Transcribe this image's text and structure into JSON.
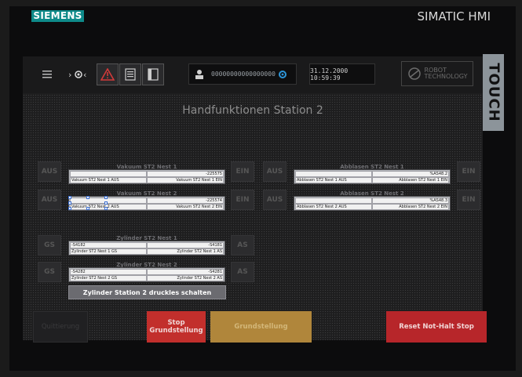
{
  "brand": "SIEMENS",
  "product": "SIMATIC HMI",
  "touch_label": "TOUCH",
  "topbar": {
    "menu_icon": "hamburger-icon",
    "icons": [
      "gearhead-icon",
      "warning-icon",
      "list-icon",
      "screen-icon"
    ],
    "status_value": "00000000000000000",
    "datetime": "31.12.2000 10:59:39",
    "logo_line1": "ROBOT",
    "logo_line2": "TECHNOLOGY"
  },
  "title": "Handfunktionen Station 2",
  "left_buttons": [
    "AUS",
    "AUS",
    "GS",
    "GS"
  ],
  "right_buttons_left": [
    "EIN",
    "EIN",
    "AS",
    "AS"
  ],
  "mid_buttons": [
    "AUS",
    "AUS"
  ],
  "right_buttons_right": [
    "EIN",
    "EIN"
  ],
  "panels": [
    {
      "title": "Vakuum ST2 Nest 1",
      "top_left": "",
      "top_right": "-225575",
      "bot_left": "Vakuum ST2 Nest 1 AUS",
      "bot_right": "Vakuum ST2 Nest 1 EIN"
    },
    {
      "title": "Vakuum ST2 Nest 2",
      "top_left": "",
      "top_right": "-225574",
      "bot_left": "Vakuum ST2 Nest 2 AUS",
      "bot_right": "Vakuum ST2 Nest 2 EIN"
    },
    {
      "title": "Abblasen ST2 Nest 1",
      "top_left": "",
      "top_right": "%AS48.2",
      "bot_left": "Abblasen ST2 Nest 1 AUS",
      "bot_right": "Abblasen ST2 Nest 1 EIN"
    },
    {
      "title": "Abblasen ST2 Nest 2",
      "top_left": "",
      "top_right": "%AS48.3",
      "bot_left": "Abblasen ST2 Nest 2 AUS",
      "bot_right": "Abblasen ST2 Nest 2 EIN"
    },
    {
      "title": "Zylinder ST2 Nest 1",
      "top_left": "-S4182",
      "top_right": "-S4181",
      "bot_left": "Zylinder ST2 Nest 1 GS",
      "bot_right": "Zylinder ST2 Nest 1 AS"
    },
    {
      "title": "Zylinder ST2 Nest 2",
      "top_left": "-S4282",
      "top_right": "-S4281",
      "bot_left": "Zylinder ST2 Nest 2 GS",
      "bot_right": "Zylinder ST2 Nest 2 AS"
    }
  ],
  "wide_button": "Zylinder Station 2 druckles schalten",
  "bottom": {
    "quittierung": "Quittierung",
    "stop": "Stop Grundstellung",
    "grundstellung": "Grundstellung",
    "reset": "Reset Not-Halt Stop"
  },
  "colors": {
    "stop": "#c22f2c",
    "grundstellung": "#b0863b",
    "reset": "#b7262a",
    "brand": "#0e8a89"
  }
}
